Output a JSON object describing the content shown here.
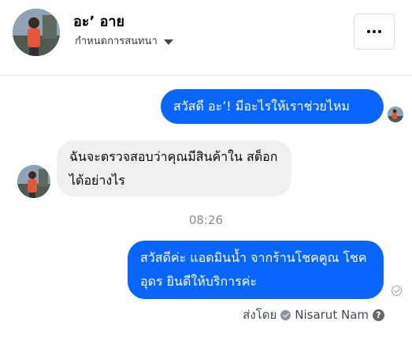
{
  "contact": {
    "name": "อะ’ อาย",
    "manage_label": "กำหนดการสนทนา",
    "more_icon": "more-horizontal-icon"
  },
  "messages": [
    {
      "direction": "outgoing",
      "text": "สวัสดี อะ’! มีอะไรให้เราช่วยไหม"
    },
    {
      "direction": "incoming",
      "text": "ฉันจะตรวจสอบว่าคุณมีสินค้าใน สต็อกได้อย่างไร"
    },
    {
      "direction": "outgoing",
      "text": "สวัสดีค่ะ แอดมินน้ำ จากร้านโชคคูณ โชคอุดร ยินดีให้บริการค่ะ"
    }
  ],
  "timestamp": "08:26",
  "footer": {
    "sent_by_label": "ส่งโดย",
    "sender_name": "Nisarut Nam",
    "help_icon": "?"
  },
  "colors": {
    "outgoing_bubble": "#0866ff",
    "incoming_bubble": "#f0f0f0"
  }
}
